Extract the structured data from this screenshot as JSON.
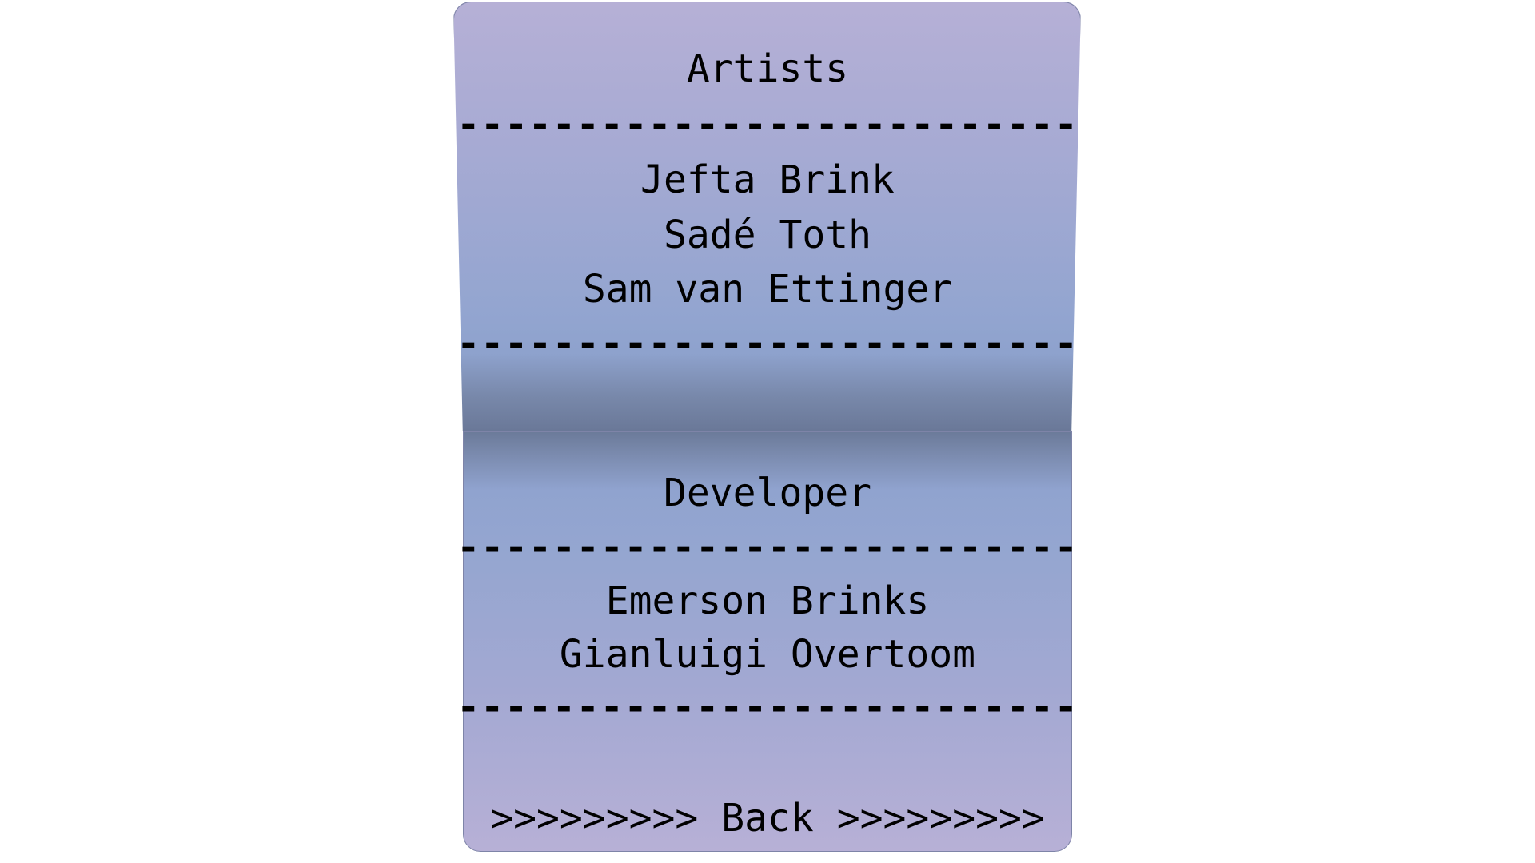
{
  "artists": {
    "heading": "Artists",
    "divider": "--------------------------",
    "names": [
      "Jefta Brink",
      "Sadé Toth",
      "Sam van Ettinger"
    ]
  },
  "developer": {
    "heading": "Developer",
    "divider": "--------------------------",
    "names": [
      "Emerson Brinks",
      "Gianluigi Overtoom"
    ]
  },
  "back_button": {
    "label": ">>>>>>>>> Back >>>>>>>>>"
  },
  "colors": {
    "panel_top": "#b6b0d6",
    "panel_mid": "#8ea2cd",
    "panel_fold": "#6a7898",
    "text": "#000000"
  }
}
